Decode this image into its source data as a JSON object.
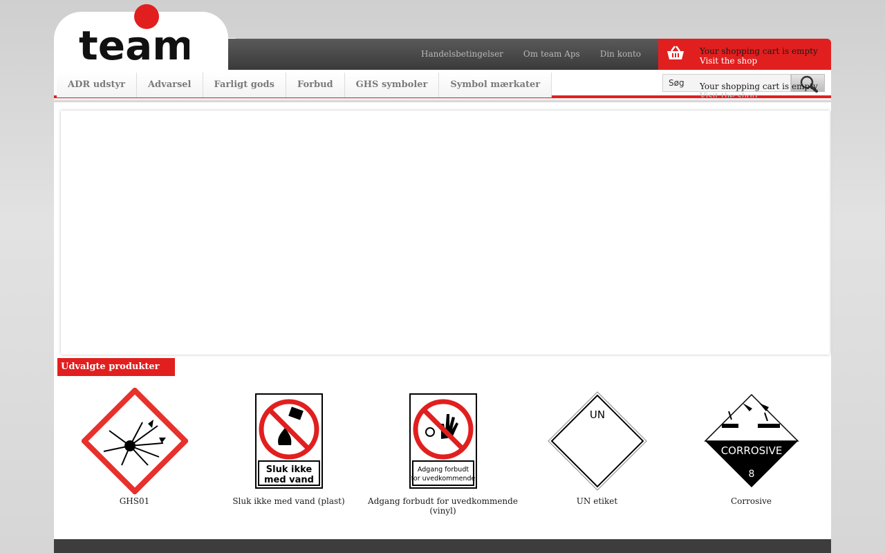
{
  "header": {
    "logo_text": "team",
    "top_links": [
      "Handelsbetingelser",
      "Om team Aps",
      "Din konto"
    ],
    "cart": {
      "status": "Your shopping cart is empty",
      "link": "Visit the shop"
    }
  },
  "nav": {
    "items": [
      "ADR udstyr",
      "Advarsel",
      "Farligt gods",
      "Forbud",
      "GHS symboler",
      "Symbol mærkater"
    ],
    "search_value": "Søg"
  },
  "cart_overlay": {
    "status": "Your shopping cart is empty",
    "link": "Visit the shop"
  },
  "featured": {
    "title": "Udvalgte produkter",
    "products": [
      {
        "name": "GHS01",
        "icon": "ghs01-explosive-icon"
      },
      {
        "name": "Sluk ikke med vand (plast)",
        "icon": "no-water-extinguish-icon",
        "sign_text": [
          "Sluk ikke",
          "med vand"
        ]
      },
      {
        "name": "Adgang forbudt for uvedkommende (vinyl)",
        "icon": "no-unauthorized-access-icon",
        "sign_text": [
          "Adgang forbudt",
          "for uvedkommende"
        ]
      },
      {
        "name": "UN etiket",
        "icon": "un-label-icon",
        "sign_text": [
          "UN"
        ]
      },
      {
        "name": "Corrosive",
        "icon": "corrosive-class8-icon",
        "sign_text": [
          "CORROSIVE",
          "8"
        ]
      }
    ]
  },
  "colors": {
    "accent": "#e11f1f",
    "dark_bar": "#3a3a3a"
  }
}
